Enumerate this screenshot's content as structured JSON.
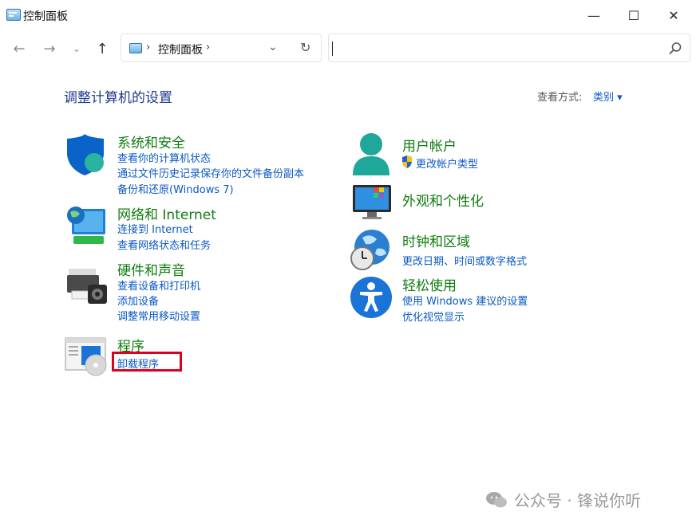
{
  "window": {
    "title": "控制面板",
    "minimize": "—",
    "maximize": "☐",
    "close": "✕"
  },
  "nav": {
    "back": "←",
    "forward": "→",
    "recent": "⌄",
    "up": "↑"
  },
  "address": {
    "sep1": "›",
    "crumb": "控制面板",
    "sep2": "›",
    "dropdown": "⌄",
    "refresh": "↻"
  },
  "search": {
    "placeholder": ""
  },
  "header": {
    "title": "调整计算机的设置",
    "view_by_label": "查看方式:",
    "view_by_value": "类别 ▾"
  },
  "categories": {
    "system": {
      "title": "系统和安全",
      "links": [
        "查看你的计算机状态",
        "通过文件历史记录保存你的文件备份副本",
        "备份和还原(Windows 7)"
      ]
    },
    "network": {
      "title": "网络和 Internet",
      "links": [
        "连接到 Internet",
        "查看网络状态和任务"
      ]
    },
    "hardware": {
      "title": "硬件和声音",
      "links": [
        "查看设备和打印机",
        "添加设备",
        "调整常用移动设置"
      ]
    },
    "programs": {
      "title": "程序",
      "links": [
        "卸载程序"
      ]
    },
    "accounts": {
      "title": "用户帐户",
      "links": [
        "更改帐户类型"
      ]
    },
    "appearance": {
      "title": "外观和个性化",
      "links": []
    },
    "clock": {
      "title": "时钟和区域",
      "links": [
        "更改日期、时间或数字格式"
      ]
    },
    "ease": {
      "title": "轻松使用",
      "links": [
        "使用 Windows 建议的设置",
        "优化视觉显示"
      ]
    }
  },
  "watermark": {
    "text": "公众号 · 锋说你听"
  },
  "colors": {
    "title_blue": "#1e3a8a",
    "category_green": "#107c10",
    "link_blue": "#0b59c4",
    "highlight_red": "#e0001b"
  }
}
